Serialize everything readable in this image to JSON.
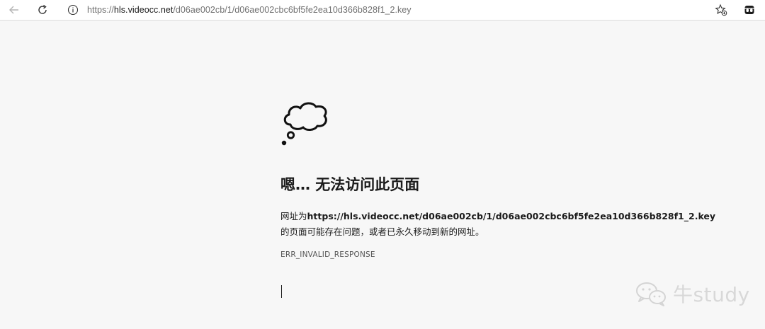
{
  "browser": {
    "address_bar": {
      "url_prefix": "https://",
      "url_host": "hls.videocc.net",
      "url_path": "/d06ae002cb/1/d06ae002cbc6bf5fe2ea10d366b828f1_2.key"
    }
  },
  "error_page": {
    "title": "嗯… 无法访问此页面",
    "line1_prefix": "网址为",
    "line1_url": "https://hls.videocc.net/d06ae002cb/1/d06ae002cbc6bf5fe2ea10d366b828f1_2.key",
    "line2": "的页面可能存在问题，或者已永久移动到新的网址。",
    "error_code": "ERR_INVALID_RESPONSE"
  },
  "watermark": {
    "text": "牛study"
  },
  "icons": {
    "back": "arrow-left-icon",
    "refresh": "refresh-icon",
    "info": "info-icon",
    "favorite": "star-add-icon",
    "extension": "extension-icon",
    "cloud": "thought-cloud-icon",
    "wechat": "wechat-icon"
  },
  "colors": {
    "page_bg": "#f7f7f7",
    "toolbar_bg": "#ffffff",
    "text": "#1b1b1b",
    "muted": "#707070",
    "watermark": "#d8d8d8"
  }
}
